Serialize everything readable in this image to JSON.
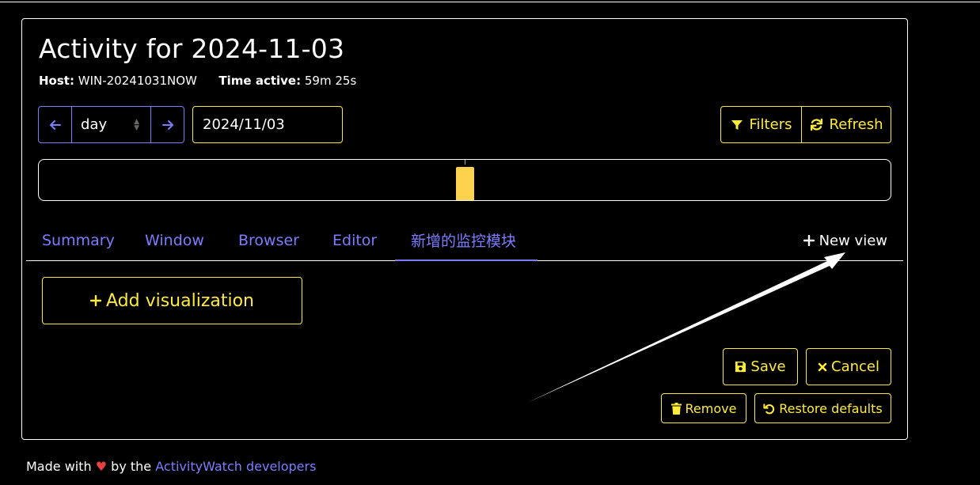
{
  "header": {
    "title": "Activity for 2024-11-03",
    "host_label": "Host:",
    "host_value": "WIN-20241031NOW",
    "time_label": "Time active:",
    "time_value": "59m 25s"
  },
  "controls": {
    "period_value": "day",
    "date_value": "2024/11/03",
    "filters_label": "Filters",
    "refresh_label": "Refresh"
  },
  "tabs": [
    {
      "label": "Summary",
      "active": false
    },
    {
      "label": "Window",
      "active": false
    },
    {
      "label": "Browser",
      "active": false
    },
    {
      "label": "Editor",
      "active": false
    },
    {
      "label": "新增的监控模块",
      "active": true
    }
  ],
  "new_view_label": "New view",
  "add_visualization_label": "Add visualization",
  "actions": {
    "save_label": "Save",
    "cancel_label": "Cancel",
    "remove_label": "Remove",
    "restore_label": "Restore defaults"
  },
  "footer": {
    "made_with": "Made with",
    "by_the": "by the",
    "link_text": "ActivityWatch developers"
  },
  "colors": {
    "accent": "#7c7cff",
    "button": "#ffeb3b",
    "timeline_bar": "#ffd24d"
  }
}
